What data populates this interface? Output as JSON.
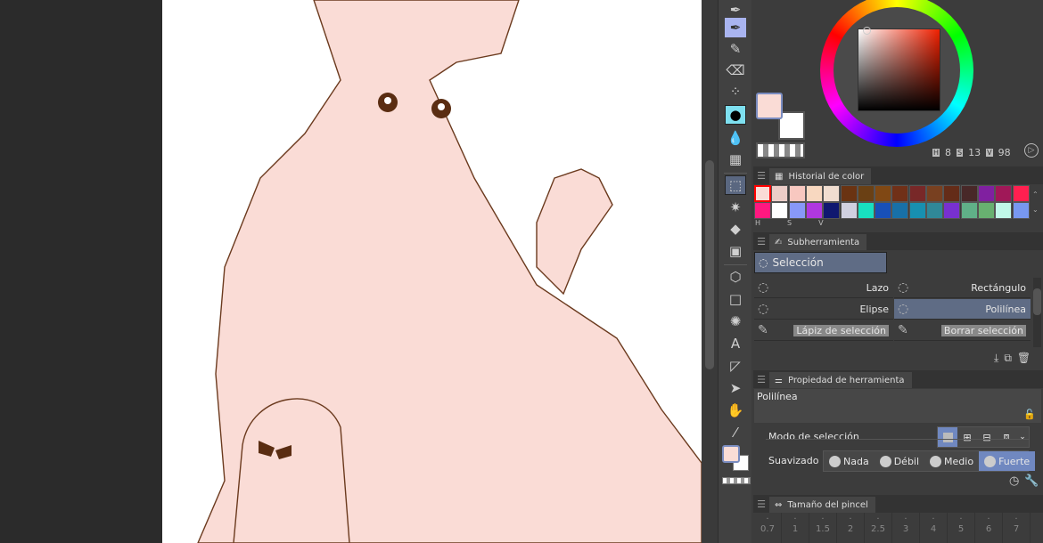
{
  "colors": {
    "main": "#fadcd6",
    "sub": "#ffffff",
    "accent": "#6a80b8"
  },
  "color_wheel": {
    "h_label": "H",
    "h": "8",
    "s_label": "S",
    "s": "13",
    "v_label": "V",
    "v": "98"
  },
  "color_history": {
    "title": "Historial de color",
    "hsv_labels": [
      "H",
      "S",
      "V"
    ],
    "swatches": [
      "#fadcd6",
      "#eccdc8",
      "#f8c8c0",
      "#f8d8c0",
      "#f0ddd0",
      "#6a3312",
      "#6a4014",
      "#804814",
      "#703018",
      "#782828",
      "#784020",
      "#642c18",
      "#482828",
      "#8020a0",
      "#a01858",
      "#ff2050",
      "#ff1880",
      "#ffffff",
      "#8898f8",
      "#b038e0",
      "#101870",
      "#d0d0e0",
      "#18e0c0",
      "#1850b8",
      "#1870a8",
      "#1890b0",
      "#308898",
      "#7830d0",
      "#60b088",
      "#68b070",
      "#c0f8e8",
      "#7898f0"
    ]
  },
  "subtool": {
    "title": "Subherramienta",
    "group": "Selección",
    "items": [
      {
        "label": "Lazo",
        "icon": "lasso-icon"
      },
      {
        "label": "Rectángulo",
        "icon": "rectangle-select-icon"
      },
      {
        "label": "Elipse",
        "icon": "ellipse-select-icon"
      },
      {
        "label": "Polilínea",
        "icon": "polyline-icon",
        "selected": true
      },
      {
        "label": "Lápiz de selección",
        "icon": "selection-pen-icon"
      },
      {
        "label": "Borrar selección",
        "icon": "erase-selection-icon"
      }
    ]
  },
  "tool_property": {
    "title": "Propiedad de herramienta",
    "tool_name": "Polilínea",
    "mode_label": "Modo de selección",
    "smoothing_label": "Suavizado",
    "smoothing_options": [
      "Nada",
      "Débil",
      "Medio",
      "Fuerte"
    ],
    "smoothing_selected": "Fuerte"
  },
  "brush_size": {
    "title": "Tamaño del pincel",
    "sizes": [
      "0.7",
      "1",
      "1.5",
      "2",
      "2.5",
      "3",
      "4",
      "5",
      "6",
      "7"
    ]
  }
}
